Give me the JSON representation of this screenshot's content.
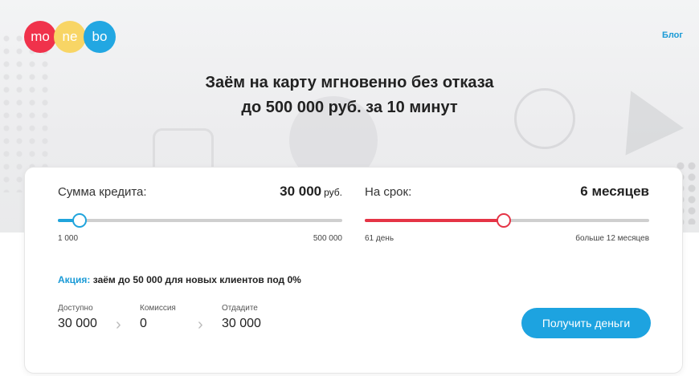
{
  "header": {
    "logo": [
      "mo",
      "ne",
      "bo"
    ],
    "blog_link": "Блог"
  },
  "hero": {
    "title_line1": "Заём на карту мгновенно без отказа",
    "title_line2": "до 500 000 руб. за 10 минут"
  },
  "calculator": {
    "amount": {
      "label": "Сумма кредита:",
      "value": "30 000",
      "unit": "руб.",
      "min_label": "1 000",
      "max_label": "500 000",
      "slider_fraction": 0.075
    },
    "term": {
      "label": "На срок:",
      "value": "6 месяцев",
      "min_label": "61 день",
      "max_label": "больше 12 месяцев",
      "slider_fraction": 0.49
    },
    "promo": {
      "key": "Акция:",
      "text": " заём до 50 000 для новых клиентов под 0%"
    },
    "summary": [
      {
        "label": "Доступно",
        "value": "30 000"
      },
      {
        "label": "Комиссия",
        "value": "0"
      },
      {
        "label": "Отдадите",
        "value": "30 000"
      }
    ],
    "cta_label": "Получить деньги"
  },
  "colors": {
    "accent_blue": "#1da3e0",
    "accent_red": "#e53446",
    "logo_red": "#f0324b",
    "logo_yellow": "#f8d565",
    "logo_blue": "#22a7e2"
  },
  "icons": {
    "summary_separator": "chevron-right-icon"
  }
}
